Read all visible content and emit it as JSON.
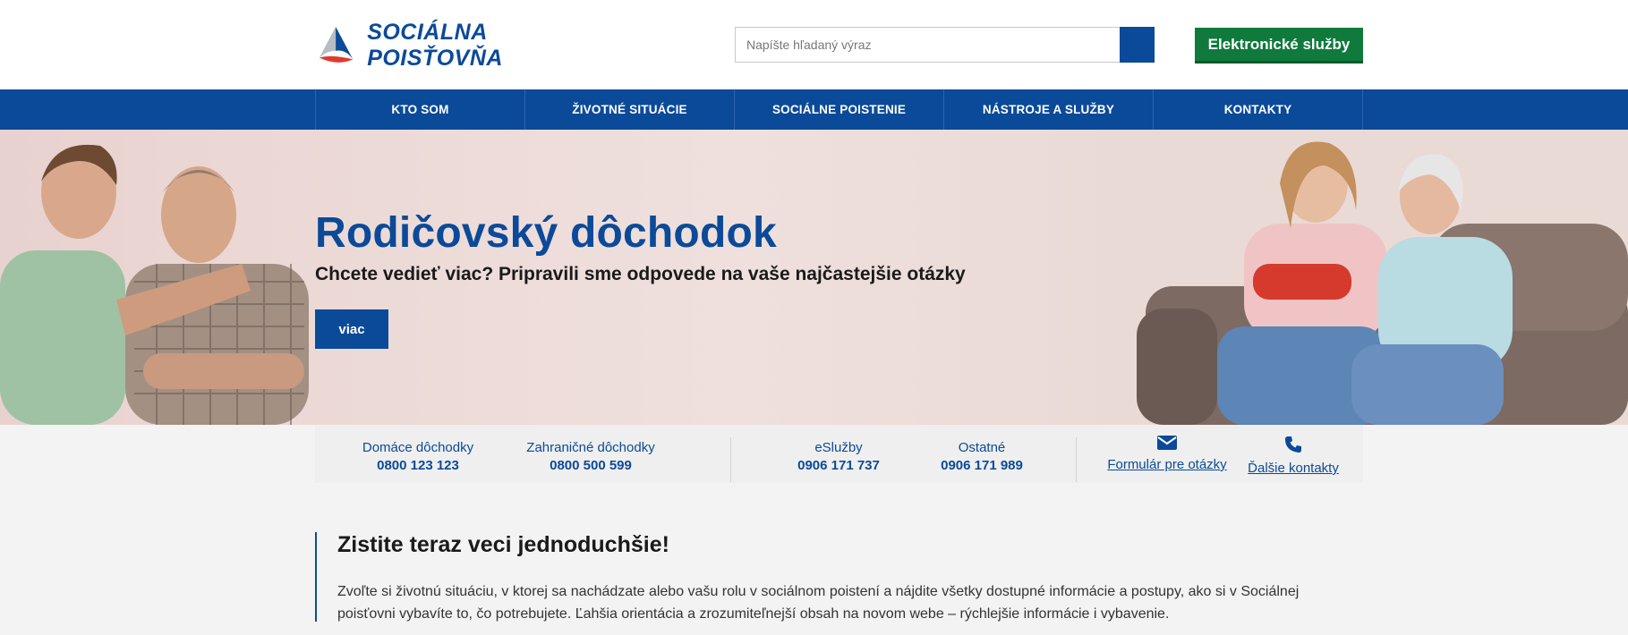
{
  "header": {
    "logo_text": "SOCIÁLNA POISŤOVŇA",
    "search_placeholder": "Napíšte hľadaný výraz",
    "eservices_label": "Elektronické služby"
  },
  "nav": {
    "items": [
      {
        "label": "KTO SOM"
      },
      {
        "label": "ŽIVOTNÉ SITUÁCIE"
      },
      {
        "label": "SOCIÁLNE POISTENIE"
      },
      {
        "label": "NÁSTROJE A SLUŽBY"
      },
      {
        "label": "KONTAKTY"
      }
    ]
  },
  "hero": {
    "title": "Rodičovský dôchodok",
    "subtitle": "Chcete vedieť viac? Pripravili sme odpovede na vaše najčastejšie otázky",
    "button_label": "viac"
  },
  "contacts": {
    "items": [
      {
        "label": "Domáce dôchodky",
        "number": "0800 123 123"
      },
      {
        "label": "Zahraničné dôchodky",
        "number": "0800 500 599"
      },
      {
        "label": "eSlužby",
        "number": "0906 171 737"
      },
      {
        "label": "Ostatné",
        "number": "0906 171 989"
      }
    ],
    "links": [
      {
        "label": "Formulár pre otázky",
        "icon": "envelope-icon"
      },
      {
        "label": "Ďalšie kontakty",
        "icon": "phone-icon"
      }
    ]
  },
  "intro": {
    "title": "Zistite teraz veci jednoduchšie!",
    "text": "Zvoľte si životnú situáciu, v ktorej sa nachádzate alebo vašu rolu v sociálnom poistení a nájdite všetky dostupné informácie a postupy, ako si v Sociálnej poisťovni vybavíte to, čo potrebujete. Ľahšia orientácia a zrozumiteľnejší obsah na novom webe – rýchlejšie informácie i vybavenie."
  },
  "colors": {
    "brand_blue": "#0b4a99",
    "eservices_green": "#0f7a3c",
    "logo_red": "#e03a2f"
  }
}
